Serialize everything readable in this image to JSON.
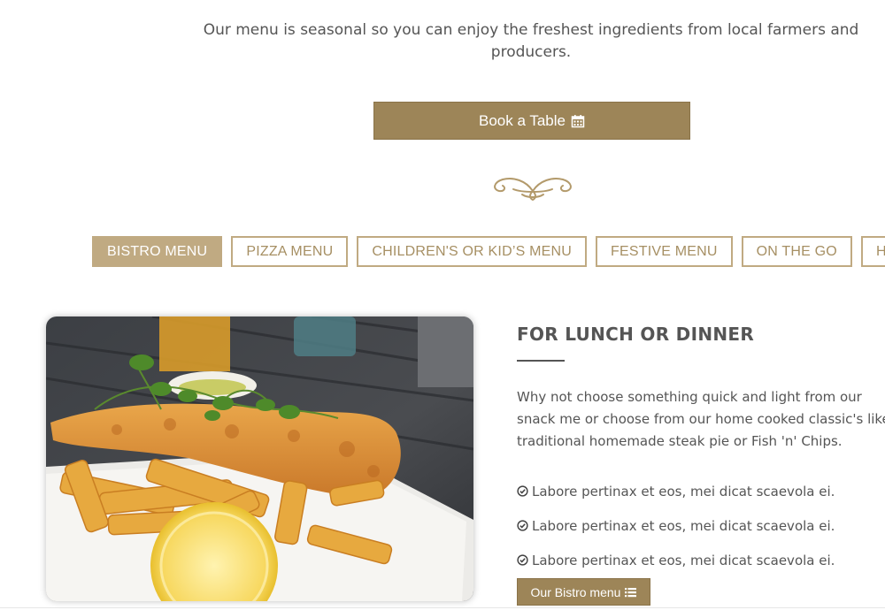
{
  "intro": {
    "text": "Our menu is seasonal so you can enjoy the freshest ingredients from local farmers and producers."
  },
  "book_button": {
    "label": "Book a Table",
    "icon": "calendar-icon"
  },
  "ornament": {
    "icon": "flourish-divider-icon"
  },
  "tabs": [
    {
      "label": "BISTRO MENU",
      "active": true
    },
    {
      "label": "PIZZA MENU",
      "active": false
    },
    {
      "label": "CHILDREN'S OR KID’S MENU",
      "active": false
    },
    {
      "label": "FESTIVE MENU",
      "active": false
    },
    {
      "label": "ON THE GO",
      "active": false
    },
    {
      "label": "HIGH T",
      "active": false
    }
  ],
  "section": {
    "title": "FOR LUNCH OR DINNER",
    "description": "Why not choose something quick and light from our snack me or choose from our home cooked classic's like traditional homemade steak pie or Fish 'n' Chips.",
    "features": [
      {
        "text": "Labore pertinax et eos, mei dicat scaevola ei.",
        "icon": "check-circle-icon"
      },
      {
        "text": "Labore pertinax et eos, mei dicat scaevola ei.",
        "icon": "check-circle-icon"
      },
      {
        "text": "Labore pertinax et eos, mei dicat scaevola ei.",
        "icon": "check-circle-icon"
      }
    ],
    "button_label": "Our Bistro menu",
    "button_icon": "list-icon"
  },
  "colors": {
    "accent": "#9d8558",
    "tab_border": "#c0aa82",
    "text": "#555555"
  }
}
